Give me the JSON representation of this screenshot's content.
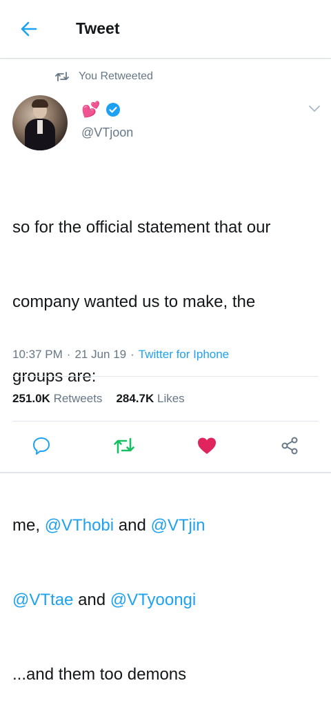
{
  "header": {
    "title": "Tweet"
  },
  "retweet_notice": "You Retweeted",
  "user": {
    "name_emoji": "💕",
    "handle": "@VTjoon"
  },
  "tweet": {
    "line1": "so for the official statement that our",
    "line2": "company wanted us to make, the",
    "line3": "groups are:",
    "line5_a": "me, ",
    "mention1": "@VThobi",
    "line5_b": " and ",
    "mention2": "@VTjin",
    "mention3": "@VTtae",
    "line6_b": " and ",
    "mention4": "@VTyoongi",
    "line7": "...and them too demons"
  },
  "meta": {
    "time": "10:37 PM",
    "sep1": "·",
    "date": "21 Jun 19",
    "sep2": "·",
    "source": "Twitter for Iphone"
  },
  "stats": {
    "retweets_count": "251.0K",
    "retweets_label": "Retweets",
    "likes_count": "284.7K",
    "likes_label": "Likes"
  },
  "colors": {
    "accent": "#1da1f2",
    "retweet_green": "#17bf63",
    "like_red": "#e0245e",
    "muted": "#657786"
  },
  "icons": [
    "back-arrow-icon",
    "retweet-icon",
    "verified-icon",
    "chevron-down-icon",
    "reply-icon",
    "retweet-icon",
    "heart-icon",
    "share-icon"
  ]
}
